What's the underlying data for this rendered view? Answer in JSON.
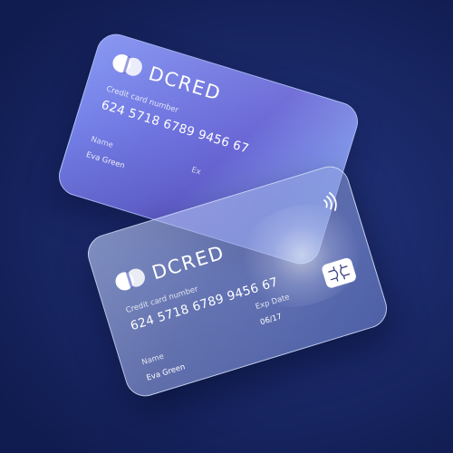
{
  "brand": "DCRED",
  "back_card": {
    "number_label": "Credit card number",
    "number": "624 5718 6789 9456 67",
    "name_label": "Name",
    "name": "Eva Green",
    "exp_label": "Ex"
  },
  "front_card": {
    "number_label": "Credit card number",
    "number": "624 5718 6789 9456 67",
    "name_label": "Name",
    "name": "Eva Green",
    "exp_label": "Exp Date",
    "exp": "06/17"
  },
  "icons": {
    "logo": "dcred-logo-icon",
    "contactless": "contactless-icon",
    "chip": "chip-icon"
  },
  "colors": {
    "background": "#1b2a6b",
    "back_card": "#6e74df",
    "front_card": "#a6b3e8"
  }
}
